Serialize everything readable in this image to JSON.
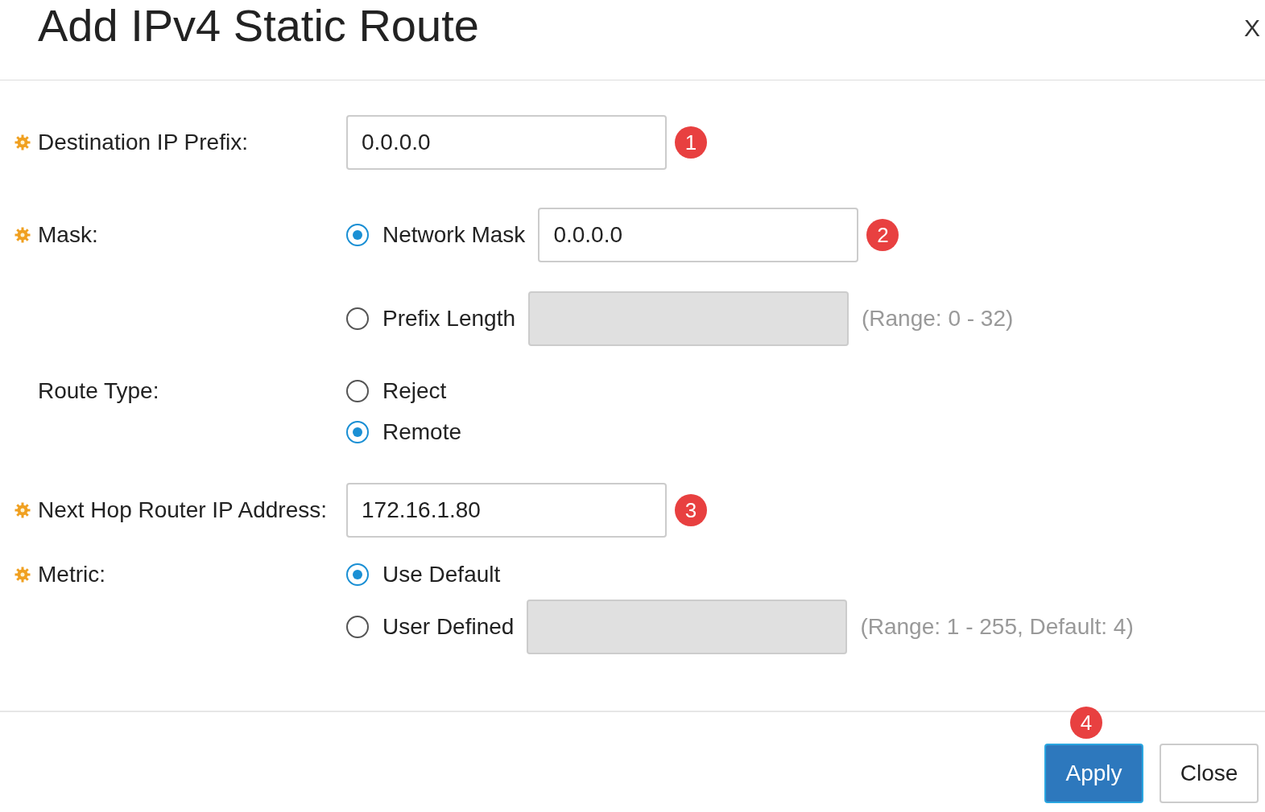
{
  "dialog": {
    "title": "Add IPv4 Static Route",
    "close": "X"
  },
  "fields": [
    {
      "kind": "text",
      "label": "Destination IP Prefix:",
      "required": true,
      "value": "0.0.0.0",
      "step": "1"
    },
    {
      "kind": "radios",
      "label": "Mask:",
      "required": true,
      "options": [
        {
          "kind": "radio-field",
          "label": "Network Mask",
          "selected": true,
          "value": "0.0.0.0",
          "step": "2"
        },
        {
          "kind": "radio-field",
          "label": "Prefix Length",
          "selected": false,
          "hint": "(Range: 0 - 32)"
        }
      ]
    },
    {
      "kind": "radios",
      "label": "Route Type:",
      "required": false,
      "options": [
        {
          "kind": "radio",
          "label": "Reject",
          "selected": false
        },
        {
          "kind": "radio",
          "label": "Remote",
          "selected": true
        }
      ]
    },
    {
      "kind": "text",
      "label": "Next Hop Router IP Address:",
      "required": true,
      "value": "172.16.1.80",
      "step": "3"
    },
    {
      "kind": "radios",
      "label": "Metric:",
      "required": true,
      "options": [
        {
          "kind": "radio",
          "label": "Use Default",
          "selected": true
        },
        {
          "kind": "radio-field",
          "label": "User Defined",
          "selected": false,
          "hint": "(Range: 1 - 255, Default: 4)"
        }
      ]
    }
  ],
  "buttons": [
    {
      "label": "Apply",
      "kind": "primary",
      "step": "4"
    },
    {
      "label": "Close",
      "kind": "secondary"
    }
  ]
}
